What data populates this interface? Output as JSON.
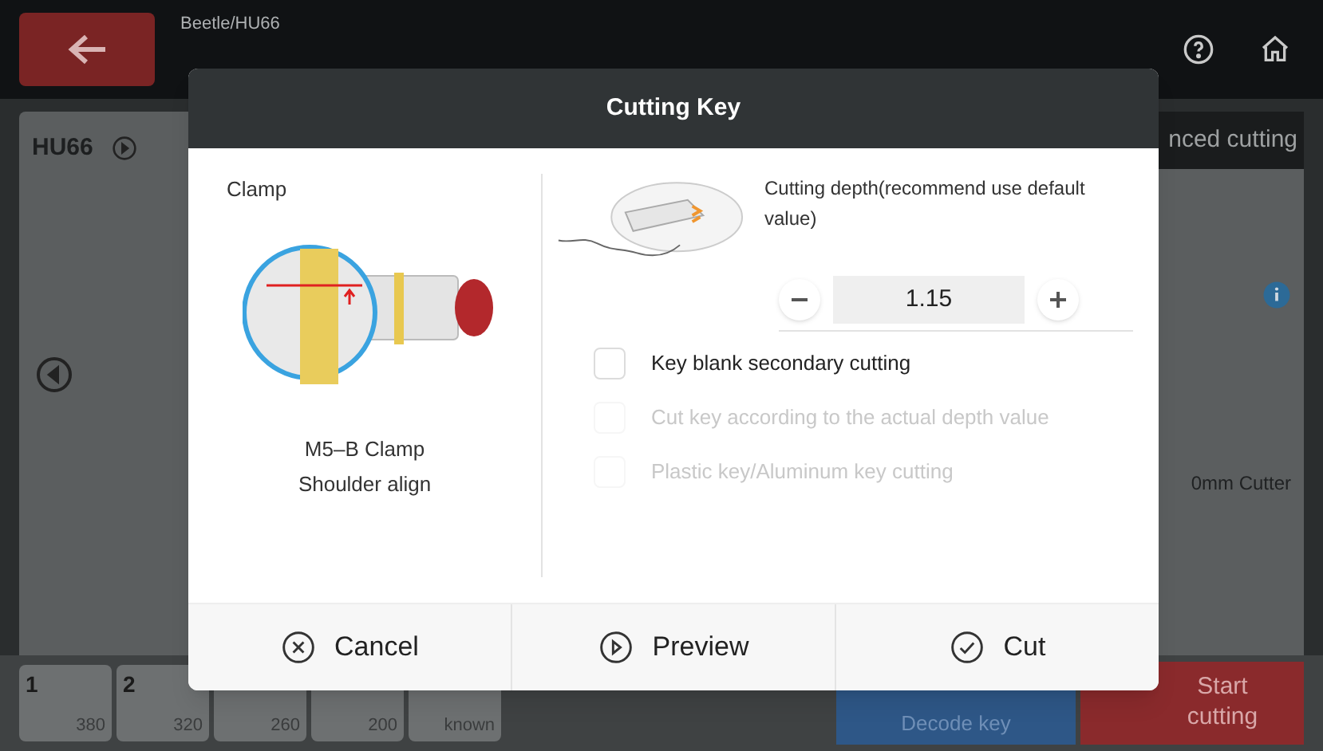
{
  "header": {
    "breadcrumb": "Beetle/HU66"
  },
  "left_panel": {
    "key_name": "HU66"
  },
  "right_panel": {
    "tab": "nced cutting",
    "cutter": "0mm Cutter"
  },
  "bottom_bar": {
    "cells": [
      {
        "label": "1",
        "value": "380"
      },
      {
        "label": "2",
        "value": "320"
      },
      {
        "value": "260"
      },
      {
        "value": "200"
      },
      {
        "value": "known"
      }
    ],
    "decode_button": "Decode key",
    "start_button": "Start cutting"
  },
  "dialog": {
    "title": "Cutting Key",
    "clamp": {
      "heading": "Clamp",
      "name": "M5–B Clamp",
      "align": "Shoulder align"
    },
    "depth": {
      "label": "Cutting depth(recommend use default value)",
      "value": "1.15"
    },
    "options": [
      {
        "label": "Key blank secondary cutting",
        "checked": false,
        "disabled": false
      },
      {
        "label": "Cut key according to the actual depth value",
        "checked": false,
        "disabled": true
      },
      {
        "label": "Plastic key/Aluminum key cutting",
        "checked": false,
        "disabled": true
      }
    ],
    "buttons": [
      {
        "kind": "cancel",
        "label": "Cancel"
      },
      {
        "kind": "preview",
        "label": "Preview"
      },
      {
        "kind": "cut",
        "label": "Cut"
      }
    ]
  }
}
